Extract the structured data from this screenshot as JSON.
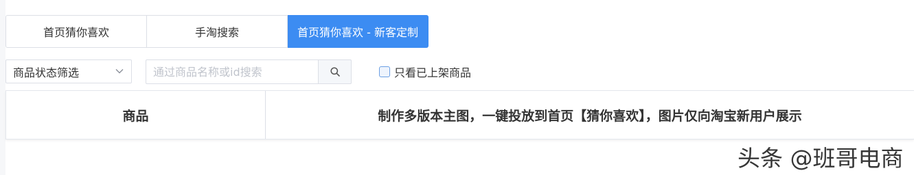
{
  "tabs": [
    {
      "label": "首页猜你喜欢",
      "active": false
    },
    {
      "label": "手淘搜索",
      "active": false
    },
    {
      "label": "首页猜你喜欢 - 新客定制",
      "active": true
    }
  ],
  "filters": {
    "status_select": {
      "selected": "商品状态筛选",
      "icon": "chevron-down-icon"
    },
    "search": {
      "placeholder": "通过商品名称或id搜索",
      "value": "",
      "button_icon": "search-icon"
    },
    "only_listed": {
      "label": "只看已上架商品",
      "checked": false
    }
  },
  "table": {
    "columns": [
      "商品",
      "制作多版本主图，一键投放到首页【猜你喜欢】，图片仅向淘宝新用户展示"
    ]
  },
  "watermark": "头条 @班哥电商",
  "colors": {
    "accent": "#3c8cf2",
    "border": "#dcdfe6",
    "text": "#333333",
    "placeholder": "#c0c4cc"
  }
}
